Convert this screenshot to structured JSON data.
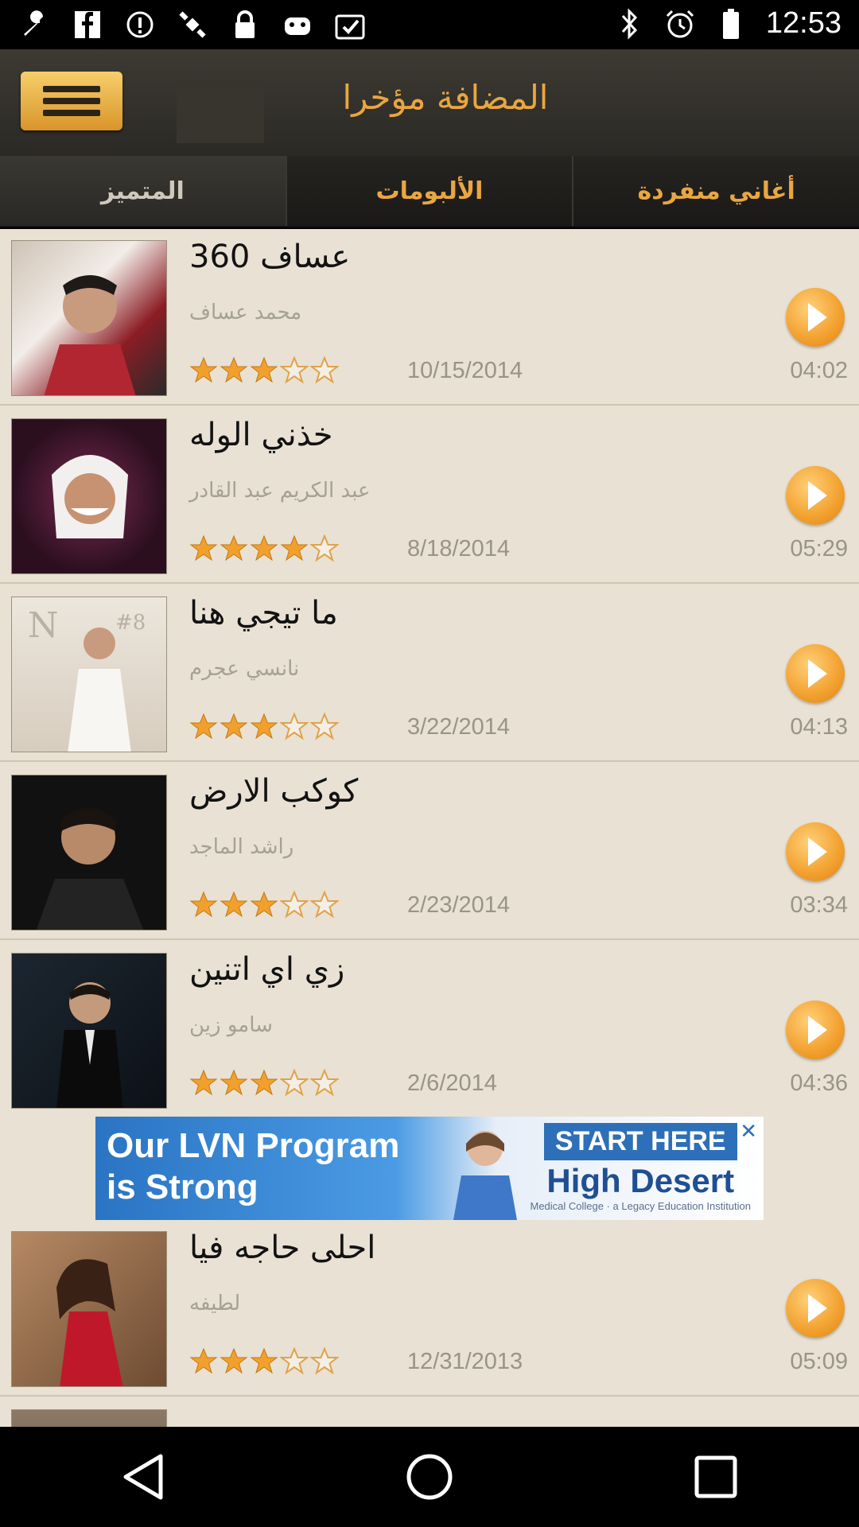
{
  "status_bar": {
    "time": "12:53",
    "left_icons": [
      "wrench-icon",
      "facebook-icon",
      "info-icon",
      "satellite-icon",
      "lock-icon",
      "android-icon",
      "task-icon"
    ],
    "right_icons": [
      "bluetooth-icon",
      "alarm-icon",
      "battery-icon"
    ]
  },
  "header": {
    "title": "المضافة مؤخرا",
    "menu_icon": "menu-icon"
  },
  "tabs": [
    {
      "label": "المتميز",
      "active": false
    },
    {
      "label": "الألبومات",
      "active": true
    },
    {
      "label": "أغاني منفردة",
      "active": true
    }
  ],
  "songs": [
    {
      "title": "عساف 360",
      "artist": "محمد عساف",
      "rating": 3,
      "date": "10/15/2014",
      "duration": "04:02"
    },
    {
      "title": "خذني الوله",
      "artist": "عبد الكريم عبد القادر",
      "rating": 4,
      "date": "8/18/2014",
      "duration": "05:29"
    },
    {
      "title": "ما تيجي هنا",
      "artist": "نانسي عجرم",
      "rating": 3,
      "date": "3/22/2014",
      "duration": "04:13"
    },
    {
      "title": "كوكب الارض",
      "artist": "راشد الماجد",
      "rating": 3,
      "date": "2/23/2014",
      "duration": "03:34"
    },
    {
      "title": "زي اي اتنين",
      "artist": "سامو زين",
      "rating": 3,
      "date": "2/6/2014",
      "duration": "04:36"
    },
    {
      "title": "احلى حاجه فيا",
      "artist": "لطيفه",
      "rating": 3,
      "date": "12/31/2013",
      "duration": "05:09"
    },
    {
      "title": "",
      "artist": "",
      "rating": 0,
      "date": "",
      "duration": ""
    }
  ],
  "ad": {
    "line1": "Our LVN Program",
    "line2": "is Strong",
    "cta": "START HERE",
    "brand": "High Desert",
    "sub": "Medical College · a Legacy Education Institution"
  },
  "colors": {
    "accent": "#e9a641",
    "list_bg": "#e8e1d4",
    "star": "#f2a02d"
  }
}
